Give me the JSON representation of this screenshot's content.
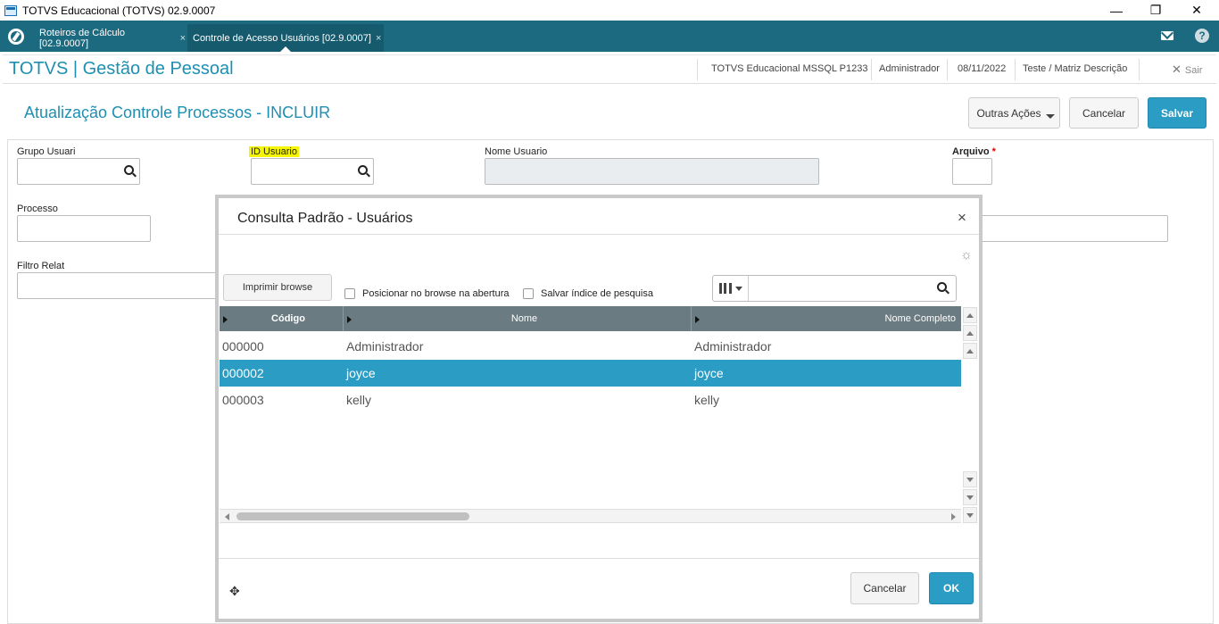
{
  "window": {
    "title": "TOTVS Educacional (TOTVS) 02.9.0007",
    "minimize": "—",
    "restore": "❐",
    "close": "✕"
  },
  "tabs": [
    {
      "label": "Roteiros de Cálculo [02.9.0007]",
      "close": "×"
    },
    {
      "label": "Controle de Acesso Usuários [02.9.0007]",
      "close": "×"
    }
  ],
  "header": {
    "brand": "TOTVS | Gestão de Pessoal",
    "environment": "TOTVS Educacional MSSQL P1233",
    "user": "Administrador",
    "date": "08/11/2022",
    "company": "Teste / Matriz Descrição",
    "exit_label": "Sair",
    "exit_icon": "✕"
  },
  "page": {
    "title": "Atualização Controle Processos - INCLUIR",
    "buttons": {
      "other_actions": "Outras Ações",
      "cancel": "Cancelar",
      "save": "Salvar"
    }
  },
  "form": {
    "grupo_usuari": {
      "label": "Grupo Usuari"
    },
    "id_usuario": {
      "label": "ID Usuario"
    },
    "nome_usuario": {
      "label": "Nome Usuario"
    },
    "arquivo": {
      "label": "Arquivo",
      "required": "*"
    },
    "processo": {
      "label": "Processo"
    },
    "filtro_relat": {
      "label": "Filtro Relat"
    }
  },
  "modal": {
    "title": "Consulta Padrão - Usuários",
    "close": "×",
    "settings_icon": "☼",
    "print_button": "Imprimir browse",
    "checkboxes": [
      {
        "label": "Posicionar no browse na abertura",
        "checked": false
      },
      {
        "label": "Salvar índice de pesquisa",
        "checked": false
      }
    ],
    "search": {
      "value": ""
    },
    "grid": {
      "columns": [
        "Código",
        "Nome",
        "Nome Completo"
      ],
      "rows": [
        {
          "codigo": "000000",
          "nome": "Administrador",
          "nome_completo": "Administrador",
          "selected": false
        },
        {
          "codigo": "000002",
          "nome": "joyce",
          "nome_completo": "joyce",
          "selected": true
        },
        {
          "codigo": "000003",
          "nome": "kelly",
          "nome_completo": "kelly",
          "selected": false
        }
      ]
    },
    "move_icon": "✥",
    "buttons": {
      "cancel": "Cancelar",
      "ok": "OK"
    }
  },
  "colors": {
    "accent": "#2b9cc3",
    "tabbar": "#1b6a80",
    "brand_text": "#1e8fb2",
    "grid_header": "#6a7b82",
    "highlight": "#f5f500"
  }
}
